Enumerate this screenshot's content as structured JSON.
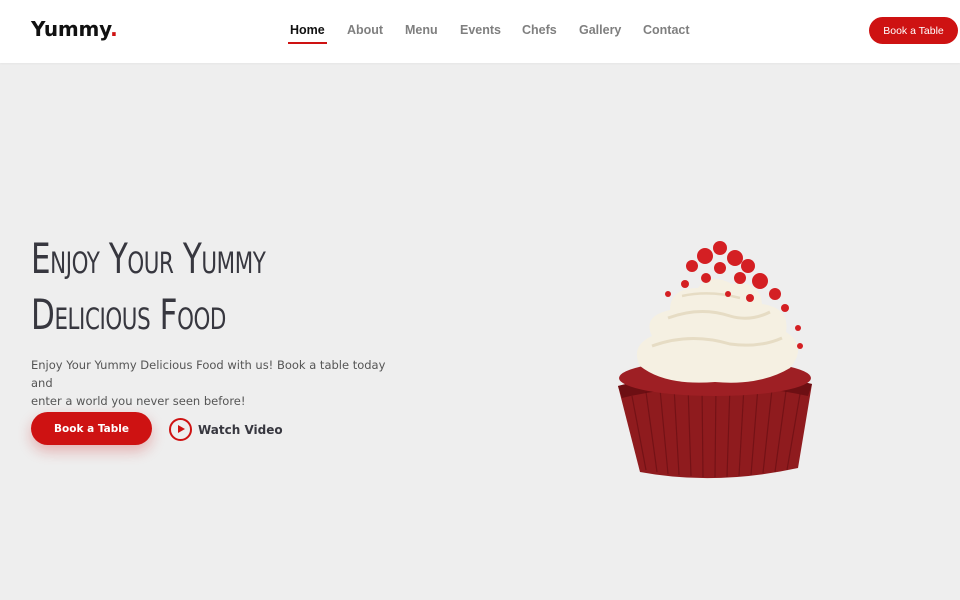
{
  "brand": {
    "name": "Yummy",
    "dot": "."
  },
  "nav": {
    "items": [
      {
        "label": "Home",
        "active": true
      },
      {
        "label": "About"
      },
      {
        "label": "Menu"
      },
      {
        "label": "Events"
      },
      {
        "label": "Chefs"
      },
      {
        "label": "Gallery"
      },
      {
        "label": "Contact"
      }
    ]
  },
  "header": {
    "cta_label": "Book a Table"
  },
  "hero": {
    "title_line1": "Enjoy Your Yummy",
    "title_line2": "Delicious Food",
    "subtitle_line1": "Enjoy Your Yummy Delicious Food with us! Book a table today and",
    "subtitle_line2": "enter a world you never seen before!",
    "cta_label": "Book a Table",
    "video_label": "Watch Video",
    "image": "red-velvet-cupcake-image"
  },
  "colors": {
    "accent": "#ce1212",
    "background": "#eeeeee",
    "heading": "#37373f"
  }
}
